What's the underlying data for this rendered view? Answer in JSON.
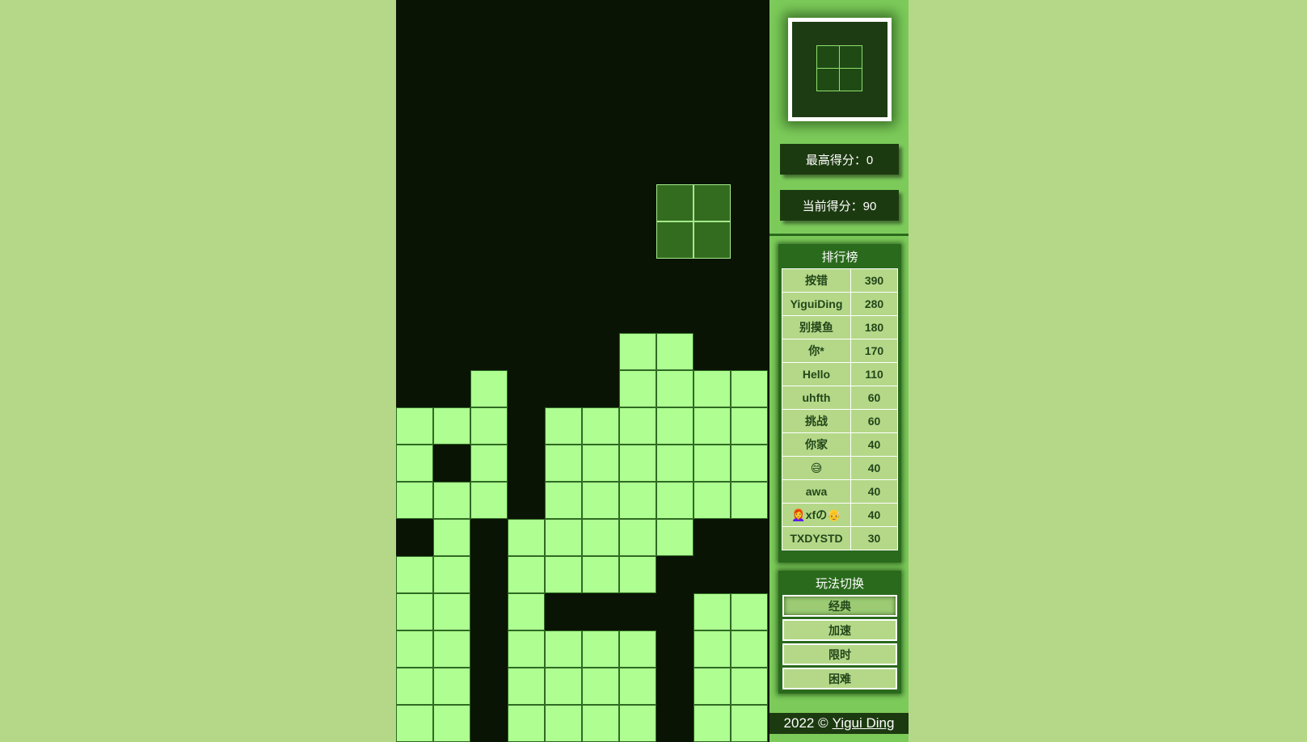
{
  "board": {
    "columns": 10,
    "rows": 20,
    "settled_rows": [
      {
        "row": 9,
        "cols": [
          6,
          7
        ]
      },
      {
        "row": 10,
        "cols": [
          2,
          6,
          7,
          8,
          9
        ]
      },
      {
        "row": 11,
        "cols": [
          0,
          1,
          2,
          4,
          5,
          6,
          7,
          8,
          9
        ]
      },
      {
        "row": 12,
        "cols": [
          0,
          2,
          4,
          5,
          6,
          7,
          8,
          9
        ]
      },
      {
        "row": 13,
        "cols": [
          0,
          1,
          2,
          4,
          5,
          6,
          7,
          8,
          9
        ]
      },
      {
        "row": 14,
        "cols": [
          1,
          3,
          4,
          5,
          6,
          7
        ]
      },
      {
        "row": 15,
        "cols": [
          0,
          1,
          3,
          4,
          5,
          6
        ]
      },
      {
        "row": 16,
        "cols": [
          0,
          1,
          3,
          8,
          9
        ]
      },
      {
        "row": 17,
        "cols": [
          0,
          1,
          3,
          4,
          5,
          6,
          8,
          9
        ]
      },
      {
        "row": 18,
        "cols": [
          0,
          1,
          3,
          4,
          5,
          6,
          8,
          9
        ]
      },
      {
        "row": 19,
        "cols": [
          0,
          1,
          3,
          4,
          5,
          6,
          8,
          9
        ]
      }
    ],
    "falling_piece": {
      "shape": "O",
      "cells": [
        [
          5,
          7
        ],
        [
          5,
          8
        ],
        [
          6,
          7
        ],
        [
          6,
          8
        ]
      ]
    },
    "colors": {
      "background": "#0a1405",
      "settled": "#aefe92",
      "falling": "#336c1e"
    }
  },
  "next_piece": {
    "shape": "O"
  },
  "scores": {
    "high_label": "最高得分：0",
    "current_label": "当前得分：90"
  },
  "leaderboard": {
    "title": "排行榜",
    "entries": [
      {
        "name": "按错",
        "score": "390"
      },
      {
        "name": "YiguiDing",
        "score": "280"
      },
      {
        "name": "别摸鱼",
        "score": "180"
      },
      {
        "name": "你*",
        "score": "170"
      },
      {
        "name": "Hello",
        "score": "110"
      },
      {
        "name": "uhfth",
        "score": "60"
      },
      {
        "name": "挑战",
        "score": "60"
      },
      {
        "name": "你家",
        "score": "40"
      },
      {
        "name": "😅",
        "score": "40"
      },
      {
        "name": "awa",
        "score": "40"
      },
      {
        "name": "👩‍🦰xfの👴",
        "score": "40"
      },
      {
        "name": "TXDYSTD",
        "score": "30"
      }
    ]
  },
  "mode_switch": {
    "title": "玩法切换",
    "options": [
      "经典",
      "加速",
      "限时",
      "困难"
    ],
    "active": "经典"
  },
  "footer": {
    "prefix": "2022 ©",
    "author": "Yigui Ding"
  },
  "colors": {
    "page_bg": "#b4d888",
    "sidebar_bg": "#7ccb5a",
    "panel_dark": "#1c3a10",
    "panel_green": "#2a6a1c"
  }
}
